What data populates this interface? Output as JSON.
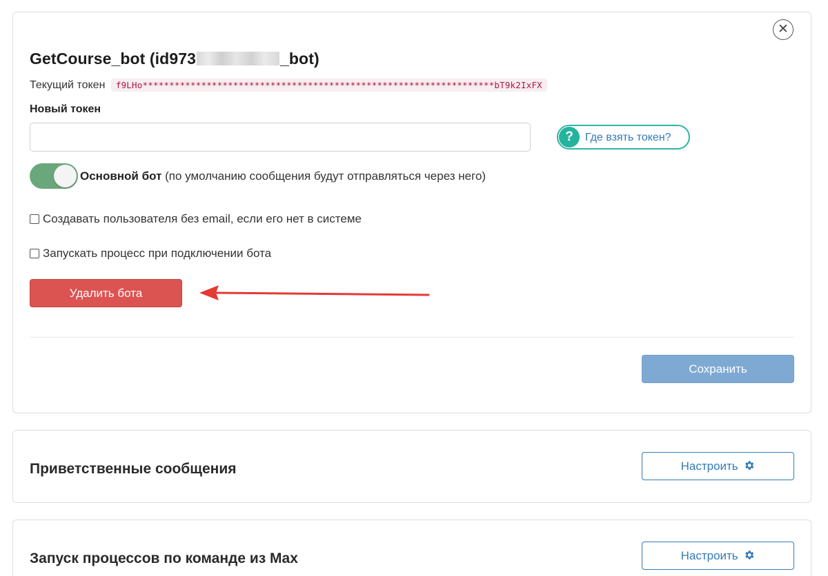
{
  "bot_panel": {
    "title_prefix": "GetCourse_bot (id973",
    "title_suffix": "_bot)",
    "current_token_label": "Текущий токен",
    "current_token_value": "f9LHo******************************************************************bT9k2IxFX",
    "new_token_label": "Новый токен",
    "new_token_value": "",
    "help_button_label": "Где взять токен?",
    "main_bot_toggle": {
      "on": true,
      "label_bold": "Основной бот",
      "label_rest": "(по умолчанию сообщения будут отправляться через него)"
    },
    "checkbox_create_user": {
      "checked": false,
      "label": "Создавать пользователя без email, если его нет в системе"
    },
    "checkbox_start_process": {
      "checked": false,
      "label": "Запускать процесс при подключении бота"
    },
    "delete_button_label": "Удалить бота",
    "save_button_label": "Сохранить",
    "close_icon": "close-icon"
  },
  "welcome_panel": {
    "title": "Приветственные сообщения",
    "button_label": "Настроить"
  },
  "process_panel": {
    "title": "Запуск процессов по команде из Max",
    "button_label": "Настроить"
  },
  "colors": {
    "delete": "#dc5452",
    "save": "#7ea9d3",
    "toggle_on": "#6aa77c",
    "help_accent": "#26b39e",
    "link_blue": "#337ab7",
    "annotation_arrow": "#e53935"
  }
}
